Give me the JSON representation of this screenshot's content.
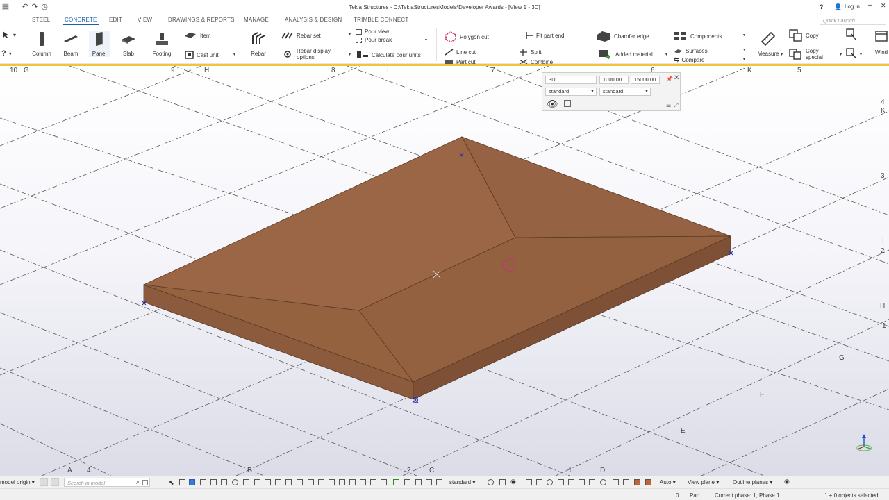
{
  "window": {
    "title": "Tekla Structures - C:\\TeklaStructuresModels\\Developer Awards - [View 1 - 3D]",
    "help": "?",
    "login": "Log in"
  },
  "tabs": [
    {
      "label": "STEEL"
    },
    {
      "label": "CONCRETE",
      "active": true
    },
    {
      "label": "EDIT"
    },
    {
      "label": "VIEW"
    },
    {
      "label": "DRAWINGS & REPORTS"
    },
    {
      "label": "MANAGE"
    },
    {
      "label": "ANALYSIS & DESIGN"
    },
    {
      "label": "TRIMBLE CONNECT"
    }
  ],
  "quick_launch": {
    "placeholder": "Quick Launch"
  },
  "ribbon": {
    "column": "Column",
    "beam": "Beam",
    "panel": "Panel",
    "slab": "Slab",
    "footing": "Footing",
    "item": "Item",
    "cast_unit": "Cast unit",
    "rebar": "Rebar",
    "rebar_set": "Rebar set",
    "rebar_display": "Rebar display options",
    "pour_view": "Pour view",
    "pour_break": "Pour break",
    "calculate_pour_units": "Calculate pour units",
    "polygon_cut": "Polygon cut",
    "line_cut": "Line cut",
    "part_cut": "Part cut",
    "fit_part_end": "Fit part end",
    "split": "Split",
    "combine": "Combine",
    "chamfer_edge": "Chamfer edge",
    "added_material": "Added material",
    "components": "Components",
    "surfaces": "Surfaces",
    "compare": "Compare",
    "measure": "Measure",
    "copy": "Copy",
    "copy_special": "Copy special",
    "windows": "Wind"
  },
  "grid_labels": [
    {
      "text": "10"
    },
    {
      "text": "G"
    },
    {
      "text": "9"
    },
    {
      "text": "H"
    },
    {
      "text": "8"
    },
    {
      "text": "I"
    },
    {
      "text": "7"
    },
    {
      "text": "6"
    },
    {
      "text": "K"
    },
    {
      "text": "5"
    },
    {
      "text": "4"
    },
    {
      "text": "K"
    },
    {
      "text": "3"
    },
    {
      "text": "I"
    },
    {
      "text": "2"
    },
    {
      "text": "H"
    },
    {
      "text": "1"
    },
    {
      "text": "G"
    },
    {
      "text": "F"
    },
    {
      "text": "E"
    },
    {
      "text": "A"
    },
    {
      "text": "4"
    },
    {
      "text": "B"
    },
    {
      "text": "2"
    },
    {
      "text": "C"
    },
    {
      "text": "1"
    },
    {
      "text": "D"
    }
  ],
  "view_panel": {
    "view_type": "3D",
    "depth_up": "1000.00",
    "depth_down": "15000.00",
    "filter1": "standard",
    "filter2": "standard"
  },
  "slab_color": "#976445",
  "accent": "#1b5fa8",
  "bottom": {
    "origin": "model origin",
    "search_placeholder": "Search in model",
    "filter": "standard",
    "snap": "Auto",
    "plane": "View plane",
    "outline": "Outline planes"
  },
  "status": {
    "value": "0",
    "mode": "Pan",
    "phase": "Current phase: 1, Phase 1",
    "selected": "1 + 0 objects selected"
  }
}
